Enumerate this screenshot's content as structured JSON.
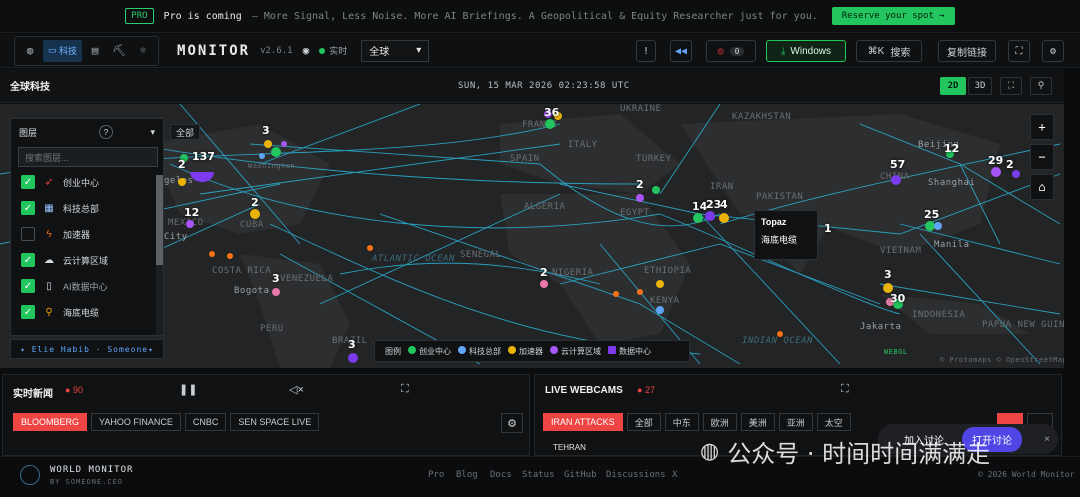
{
  "banner": {
    "pro": "PRO",
    "message": "Pro is coming",
    "tagline": "— More Signal, Less Noise. More AI Briefings. A Geopolitical & Equity Researcher just for you.",
    "cta": "Reserve your spot →"
  },
  "topbar": {
    "variants": [
      {
        "icon": "globe-icon",
        "label": ""
      },
      {
        "icon": "monitor-icon",
        "label": "科技"
      },
      {
        "icon": "chart-icon",
        "label": ""
      },
      {
        "icon": "pickaxe-icon",
        "label": ""
      },
      {
        "icon": "sun-icon",
        "label": ""
      }
    ],
    "app_name": "MONITOR",
    "version": "v2.6.1",
    "live_label": "实时",
    "region": "全球",
    "notif_count": "0",
    "windows_label": "Windows",
    "search_shortcut": "⌘K",
    "search_label": "搜索",
    "copy_link": "复制链接"
  },
  "mapbar": {
    "title": "全球科技",
    "datetime": "SUN, 15 MAR 2026 02:23:58 UTC",
    "mode_2d": "2D",
    "mode_3d": "3D"
  },
  "layers": {
    "title": "图层",
    "search_placeholder": "搜索图层...",
    "all_label": "全部",
    "items": [
      {
        "label": "创业中心",
        "checked": true,
        "icon": "rocket-icon"
      },
      {
        "label": "科技总部",
        "checked": true,
        "icon": "building-icon"
      },
      {
        "label": "加速器",
        "checked": false,
        "icon": "bolt-icon"
      },
      {
        "label": "云计算区域",
        "checked": true,
        "icon": "cloud-icon"
      },
      {
        "label": "AI数据中心",
        "checked": true,
        "icon": "server-icon"
      },
      {
        "label": "海底电缆",
        "checked": true,
        "icon": "cable-icon"
      }
    ],
    "credit": "✦ Elie Habib · Someone✦"
  },
  "map": {
    "labels": [
      "UKRAINE",
      "KAZAKHSTAN",
      "FRANCE",
      "ITALY",
      "TURKEY",
      "SPAIN",
      "IRAN",
      "PAKISTAN",
      "ALGERIA",
      "EGYPT",
      "CUBA",
      "MEXICO",
      "SENEGAL",
      "NIGERIA",
      "ETHIOPIA",
      "KENYA",
      "VENEZUELA",
      "COSTA RICA",
      "Bogota",
      "PERU",
      "BRAZIL",
      "CHINA",
      "Beijing",
      "Shanghai",
      "VIETNAM",
      "Manila",
      "INDONESIA",
      "Jakarta",
      "PAPUA NEW GUINEA",
      "City",
      "geles",
      "Washington",
      "INDIAN OCEAN",
      "ATLANTIC OCEAN",
      "WEBGL",
      "© Protomaps © OpenStreetMap"
    ],
    "clusters": [
      "36",
      "3",
      "137",
      "2",
      "12",
      "2",
      "2",
      "3",
      "2",
      "14",
      "23",
      "4",
      "1",
      "3",
      "12",
      "57",
      "29",
      "2",
      "25",
      "3",
      "30",
      "3",
      "3"
    ],
    "tooltip": {
      "title": "Topaz",
      "subtitle": "海底电缆"
    }
  },
  "legend": {
    "title": "图例",
    "items": [
      {
        "label": "创业中心",
        "color": "#22c55e"
      },
      {
        "label": "科技总部",
        "color": "#60a5fa"
      },
      {
        "label": "加速器",
        "color": "#eab308"
      },
      {
        "label": "云计算区域",
        "color": "#a855f7"
      },
      {
        "label": "数据中心",
        "color": "#7c3aed"
      }
    ]
  },
  "news": {
    "title": "实时新闻",
    "count": "90",
    "tabs": [
      "BLOOMBERG",
      "YAHOO FINANCE",
      "CNBC",
      "SEN SPACE LIVE"
    ]
  },
  "webcams": {
    "title": "LIVE WEBCAMS",
    "count": "27",
    "tabs": [
      "IRAN ATTACKS",
      "全部",
      "中东",
      "欧洲",
      "美洲",
      "亚洲",
      "太空"
    ],
    "cam_label": "TEHRAN"
  },
  "footer": {
    "brand": "WORLD MONITOR",
    "by": "BY SOMEONE.CEO",
    "links": [
      "Pro",
      "Blog",
      "Docs",
      "Status",
      "GitHub",
      "Discussions",
      "X"
    ],
    "copyright": "© 2026 World Monitor"
  },
  "chat": {
    "join": "加入讨论",
    "open": "打开讨论"
  },
  "watermark": "公众号 · 时间时间满满走"
}
